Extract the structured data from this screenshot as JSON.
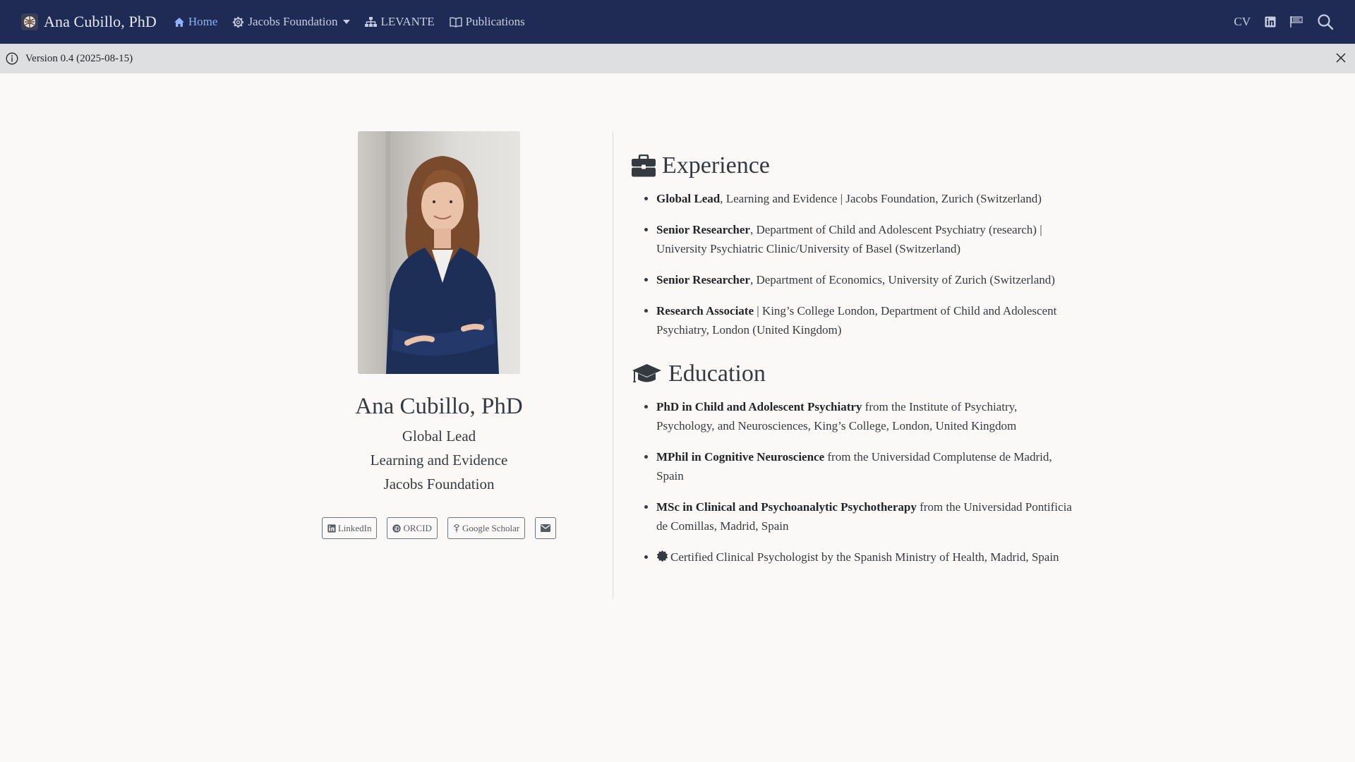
{
  "navbar": {
    "brand_title": "Ana Cubillo, PhD",
    "items": [
      {
        "label": "Home",
        "icon": "home-icon",
        "active": true
      },
      {
        "label": "Jacobs Foundation",
        "icon": "gear-icon",
        "dropdown": true
      },
      {
        "label": "LEVANTE",
        "icon": "sitemap-icon"
      },
      {
        "label": "Publications",
        "icon": "book-icon"
      }
    ],
    "right": {
      "cv_label": "CV",
      "icons": [
        "linkedin-icon",
        "orcid-flag-icon",
        "search-icon"
      ]
    },
    "colors": {
      "background": "#1f2b54",
      "active": "#8fb3f6"
    }
  },
  "announcement": {
    "text": "Version 0.4 (2025-08-15)"
  },
  "profile": {
    "name": "Ana Cubillo, PhD",
    "lines": [
      "Global Lead",
      "Learning and Evidence",
      "Jacobs Foundation"
    ],
    "links": [
      {
        "label": "LinkedIn",
        "icon": "linkedin-icon"
      },
      {
        "label": "ORCID",
        "icon": "orcid-icon"
      },
      {
        "label": "Google Scholar",
        "icon": "scholar-icon"
      },
      {
        "label": "",
        "icon": "envelope-icon"
      }
    ]
  },
  "experience": {
    "title": "Experience",
    "items": [
      {
        "role": "Global Lead",
        "rest": ", Learning and Evidence | Jacobs Foundation, Zurich (Switzerland)"
      },
      {
        "role": "Senior Researcher",
        "rest": ", Department of Child and Adolescent Psychiatry (research) | University Psychiatric Clinic/University of Basel (Switzerland)"
      },
      {
        "role": "Senior Researcher",
        "rest": ", Department of Economics, University of Zurich (Switzerland)"
      },
      {
        "role": "Research Associate",
        "rest": " | King’s College London, Department of Child and Adolescent Psychiatry, London (United Kingdom)"
      }
    ]
  },
  "education": {
    "title": "Education",
    "items": [
      {
        "degree": "PhD in Child and Adolescent Psychiatry",
        "rest": " from the Institute of Psychiatry, Psychology, and Neurosciences, King’s College, London, United Kingdom"
      },
      {
        "degree": "MPhil in Cognitive Neuroscience",
        "rest": " from the Universidad Complutense de Madrid, Spain"
      },
      {
        "degree": "MSc in Clinical and Psychoanalytic Psychotherapy",
        "rest": " from the Universidad Pontificia de Comillas, Madrid, Spain"
      }
    ],
    "certification": "Certified Clinical Psychologist by the Spanish Ministry of Health, Madrid, Spain"
  }
}
